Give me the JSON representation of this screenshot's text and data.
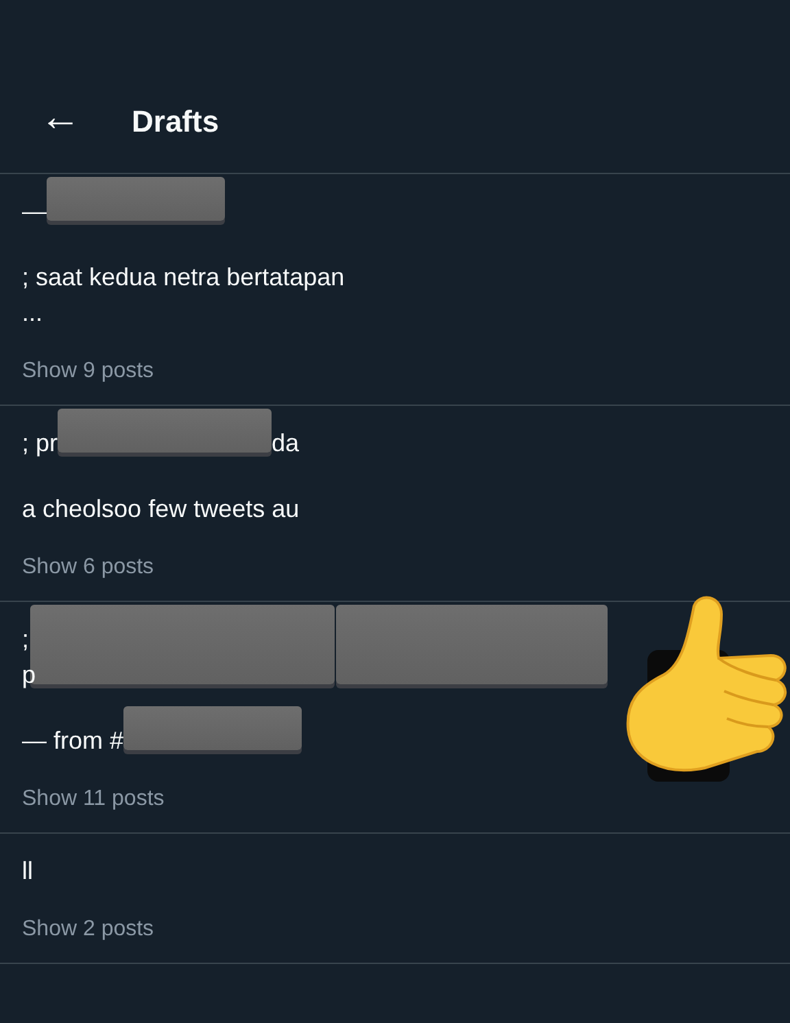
{
  "header": {
    "back": "←",
    "title": "Drafts"
  },
  "drafts": [
    {
      "paragraphs": [
        [
          [
            {
              "kind": "text",
              "text": "—"
            },
            {
              "kind": "redaction"
            }
          ]
        ],
        [
          [
            {
              "kind": "text",
              "text": "; saat kedua netra bertatapan"
            }
          ],
          [
            {
              "kind": "text",
              "text": "..."
            }
          ]
        ]
      ],
      "show": "Show 9 posts"
    },
    {
      "paragraphs": [
        [
          [
            {
              "kind": "text",
              "text": "; pr"
            },
            {
              "kind": "redaction"
            },
            {
              "kind": "text",
              "text": "da"
            }
          ]
        ],
        [
          [
            {
              "kind": "text",
              "text": "a cheolsoo few tweets au"
            }
          ]
        ]
      ],
      "show": "Show 6 posts"
    },
    {
      "paragraphs": [
        [
          [
            {
              "kind": "text",
              "text": ";"
            },
            {
              "kind": "tall-redaction"
            },
            {
              "kind": "tall-redaction"
            }
          ],
          [
            {
              "kind": "text",
              "text": "p"
            }
          ]
        ],
        [
          [
            {
              "kind": "text",
              "text": "— from #"
            },
            {
              "kind": "redaction"
            }
          ]
        ]
      ],
      "show": "Show 11 posts"
    },
    {
      "paragraphs": [
        [
          [
            {
              "kind": "text",
              "text": "ll"
            }
          ]
        ]
      ],
      "show": "Show 2 posts"
    }
  ]
}
